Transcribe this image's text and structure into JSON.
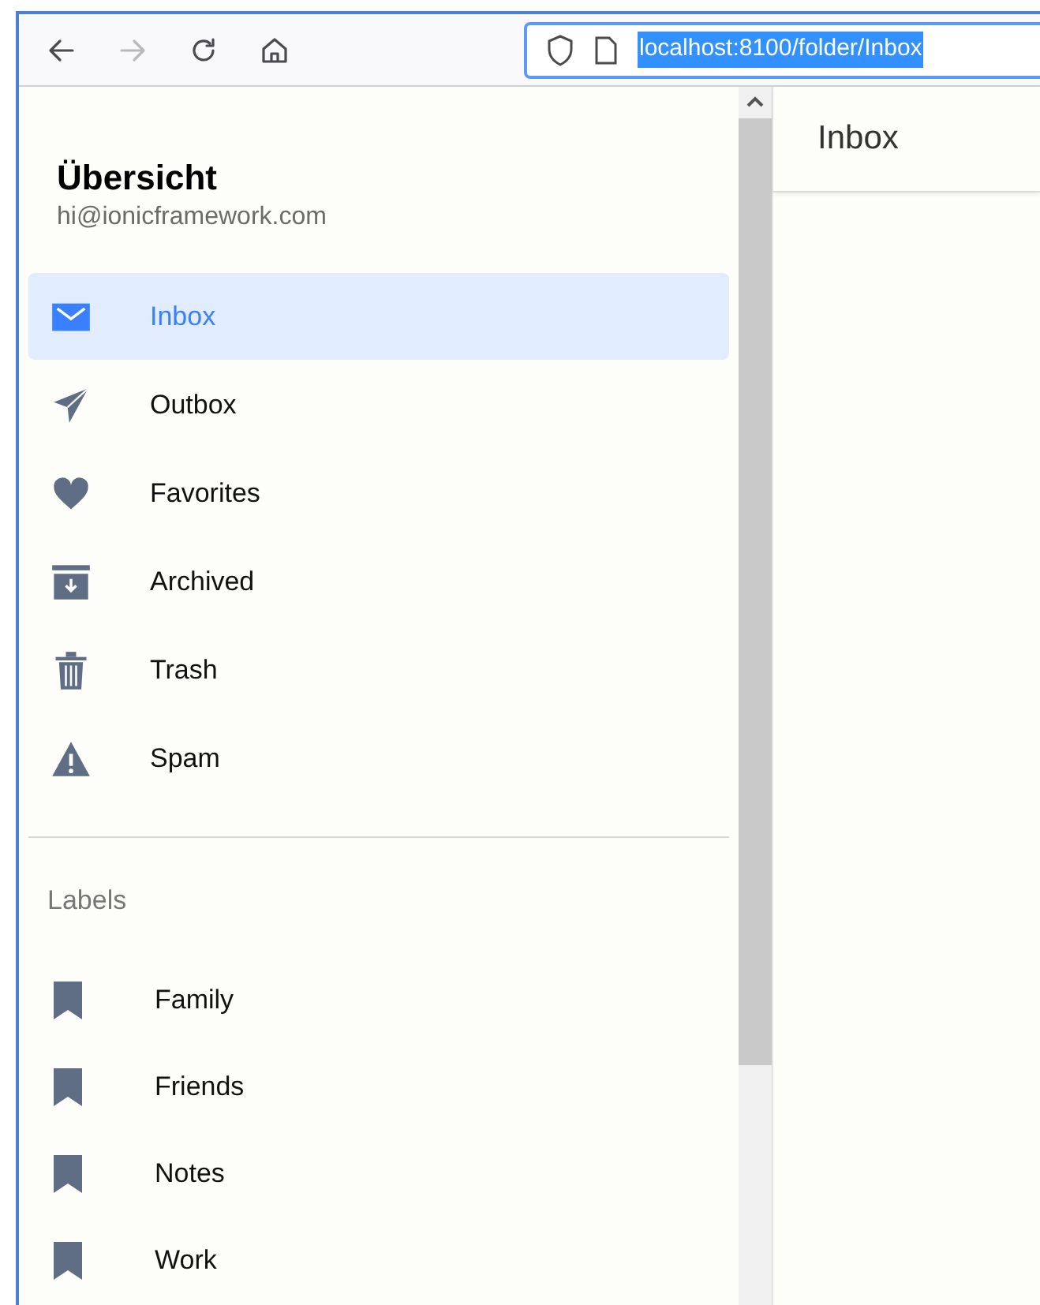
{
  "browser": {
    "nav_buttons": [
      {
        "kind": "back",
        "disabled": false
      },
      {
        "kind": "forward",
        "disabled": true
      },
      {
        "kind": "reload",
        "disabled": false
      },
      {
        "kind": "home",
        "disabled": false
      }
    ],
    "address": {
      "url": "localhost:8100/folder/Inbox",
      "selected": true
    }
  },
  "menu": {
    "title": "Übersicht",
    "email": "hi@ionicframework.com",
    "items": [
      {
        "label": "Inbox",
        "kind": "mail",
        "selected": true
      },
      {
        "label": "Outbox",
        "kind": "send",
        "selected": false
      },
      {
        "label": "Favorites",
        "kind": "heart",
        "selected": false
      },
      {
        "label": "Archived",
        "kind": "archive",
        "selected": false
      },
      {
        "label": "Trash",
        "kind": "trash",
        "selected": false
      },
      {
        "label": "Spam",
        "kind": "warning",
        "selected": false
      }
    ],
    "labels_heading": "Labels",
    "labels": [
      {
        "label": "Family"
      },
      {
        "label": "Friends"
      },
      {
        "label": "Notes"
      },
      {
        "label": "Work"
      }
    ]
  },
  "content": {
    "title": "Inbox"
  }
}
